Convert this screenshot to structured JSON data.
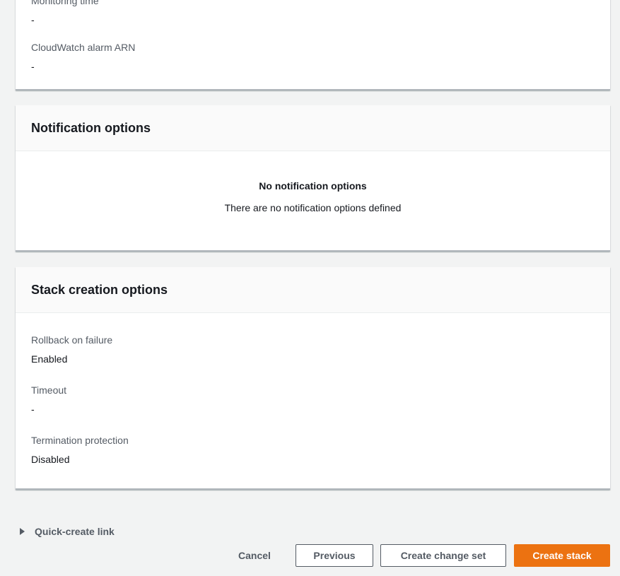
{
  "monitoring_card": {
    "partial_label": "Monitoring time",
    "partial_value": "-",
    "alarm_label": "CloudWatch alarm ARN",
    "alarm_value": "-"
  },
  "notification_card": {
    "title": "Notification options",
    "empty_title": "No notification options",
    "empty_description": "There are no notification options defined"
  },
  "stack_creation_card": {
    "title": "Stack creation options",
    "fields": [
      {
        "label": "Rollback on failure",
        "value": "Enabled"
      },
      {
        "label": "Timeout",
        "value": "-"
      },
      {
        "label": "Termination protection",
        "value": "Disabled"
      }
    ]
  },
  "quick_create": {
    "label": "Quick-create link",
    "icon": "caret-right-icon"
  },
  "footer": {
    "cancel_label": "Cancel",
    "previous_label": "Previous",
    "change_set_label": "Create change set",
    "create_label": "Create stack"
  },
  "colors": {
    "primary": "#ec7211",
    "background": "#f2f3f3",
    "text": "#16191f",
    "muted": "#545b64"
  }
}
